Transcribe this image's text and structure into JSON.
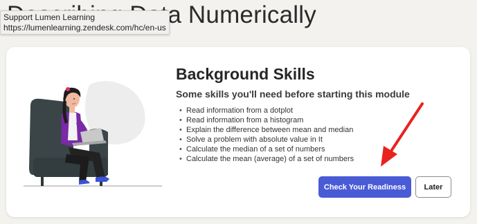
{
  "page": {
    "heading": "Describing Data Numerically"
  },
  "tooltip": {
    "line1": "Support Lumen Learning",
    "line2": "https://lumenlearning.zendesk.com/hc/en-us"
  },
  "card": {
    "title": "Background Skills",
    "subtitle": "Some skills you'll need before starting this module",
    "bullet": "•",
    "skills": [
      "Read information from a dotplot",
      "Read information from a histogram",
      "Explain the difference between mean and median",
      "Solve a problem with absolute value in It",
      "Calculate the median of a set of numbers",
      "Calculate the mean (average) of a set of numbers"
    ],
    "primary_button": "Check Your Readiness",
    "secondary_button": "Later"
  },
  "colors": {
    "primary": "#4a5bd6",
    "arrow": "#e8231f",
    "chair": "#3b4548",
    "sweater": "#7a2aa6"
  },
  "icons": {
    "illustration": "woman-in-armchair-with-laptop",
    "annotation": "red-arrow"
  }
}
